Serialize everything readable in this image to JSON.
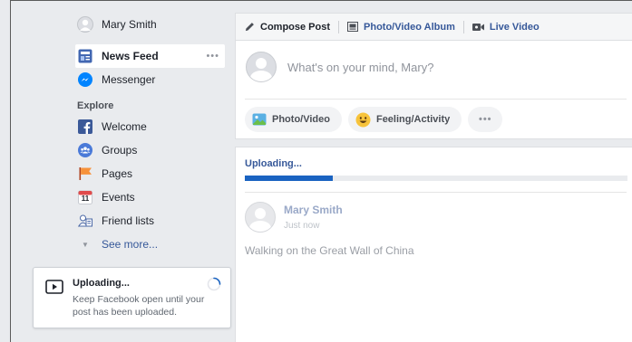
{
  "sidebar": {
    "profile": {
      "name": "Mary Smith"
    },
    "items": [
      {
        "label": "News Feed",
        "icon": "news-feed-icon",
        "active": true,
        "more": "•••"
      },
      {
        "label": "Messenger",
        "icon": "messenger-icon"
      }
    ],
    "explore_heading": "Explore",
    "explore_items": [
      {
        "label": "Welcome",
        "icon": "facebook-icon"
      },
      {
        "label": "Groups",
        "icon": "groups-icon"
      },
      {
        "label": "Pages",
        "icon": "pages-flag-icon"
      },
      {
        "label": "Events",
        "icon": "calendar-icon",
        "day": "11"
      },
      {
        "label": "Friend lists",
        "icon": "friend-lists-icon"
      }
    ],
    "see_more": "See more..."
  },
  "composer": {
    "tabs": [
      {
        "label": "Compose Post",
        "icon": "pencil-icon"
      },
      {
        "label": "Photo/Video Album",
        "icon": "album-icon"
      },
      {
        "label": "Live Video",
        "icon": "live-video-icon"
      }
    ],
    "placeholder": "What's on your mind, Mary?",
    "actions": [
      {
        "label": "Photo/Video",
        "icon": "photo-icon"
      },
      {
        "label": "Feeling/Activity",
        "icon": "smiley-icon"
      },
      {
        "label": "•••",
        "icon": "more-icon"
      }
    ]
  },
  "upload": {
    "title": "Uploading...",
    "progress": 0.23,
    "author": "Mary Smith",
    "time": "Just now",
    "body": "Walking on the Great Wall of China"
  },
  "toast": {
    "title": "Uploading...",
    "message": "Keep Facebook open until your post has been uploaded."
  },
  "colors": {
    "link": "#365899",
    "progress": "#1a63c1",
    "background": "#e9ebee"
  }
}
